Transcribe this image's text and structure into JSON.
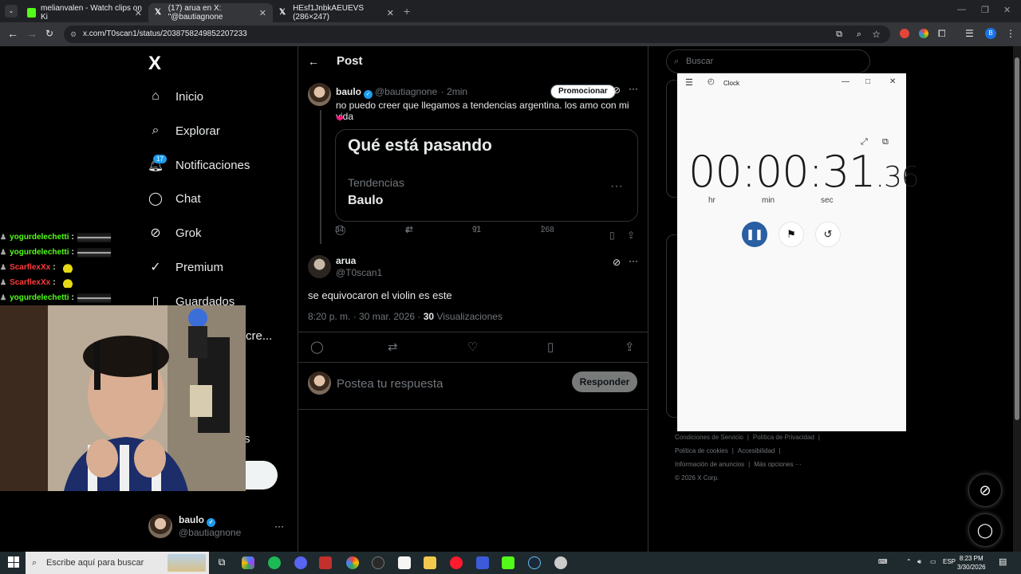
{
  "browser": {
    "tabs": [
      {
        "label": "melianvalen - Watch clips on Ki",
        "active": false,
        "icon_color": "#53fc18"
      },
      {
        "label": "(17) arua en X: \"@bautiagnone",
        "active": true,
        "icon_color": "#ffffff"
      },
      {
        "label": "HEsf1JnbkAEUEVS (286×247)",
        "active": false,
        "icon_color": "#ffffff"
      }
    ],
    "new_tab": "+",
    "url": "x.com/T0scan1/status/2038758249852207233"
  },
  "sidebar": {
    "logo": "X",
    "items": [
      {
        "label": "Inicio",
        "icon": "home-icon"
      },
      {
        "label": "Explorar",
        "icon": "search-icon"
      },
      {
        "label": "Notificaciones",
        "icon": "bell-icon"
      },
      {
        "label": "Chat",
        "icon": "chat-icon"
      },
      {
        "label": "Grok",
        "icon": "grok-icon"
      },
      {
        "label": "Premium",
        "icon": "premium-icon"
      },
      {
        "label": "Guardados",
        "icon": "bookmark-icon"
      }
    ],
    "notif_badge": "17",
    "partial_text_1": "cre...",
    "partial_text_2": "s",
    "account": {
      "name": "baulo",
      "handle": "@bautiagnone",
      "more": "···"
    }
  },
  "chat_overlay": [
    {
      "user": "yogurdelechetti",
      "color": "#53fc18",
      "sep": ":"
    },
    {
      "user": "yogurdelechetti",
      "color": "#53fc18",
      "sep": ":"
    },
    {
      "user": "ScarflexXx",
      "color": "#ff3b3b",
      "sep": ":"
    },
    {
      "user": "ScarflexXx",
      "color": "#ff3b3b",
      "sep": ":"
    },
    {
      "user": "yogurdelechetti",
      "color": "#53fc18",
      "sep": ":"
    }
  ],
  "post": {
    "header": "Post",
    "quoted": {
      "name": "baulo",
      "handle": "@bautiagnone",
      "time": "· 2min",
      "promote": "Promocionar",
      "text": "no puedo creer que llegamos a tendencias argentina. los amo con mi vida",
      "heart": "❤",
      "card": {
        "title": "Qué está pasando",
        "subtitle": "Tendencias",
        "trend": "Baulo",
        "dots": "···"
      },
      "stats": {
        "replies": "34",
        "reposts": "4",
        "likes": "91",
        "views": "268"
      }
    },
    "reply": {
      "name": "arua",
      "handle": "@T0scan1",
      "text": "se equivocaron el violin es este",
      "time": "8:20 p. m. · 30 mar. 2026 · ",
      "views_count": "30",
      "views_label": " Visualizaciones"
    },
    "compose": {
      "placeholder": "Postea tu respuesta",
      "button": "Responder"
    }
  },
  "right": {
    "search_placeholder": "Buscar",
    "footer": [
      "Condiciones de Servicio",
      "Política de Privacidad",
      "Política de cookies",
      "Accesibilidad",
      "Información de anuncios",
      "Más opciones ···",
      "© 2026 X Corp."
    ]
  },
  "clock_app": {
    "title": "Clock",
    "time_main": "00:00:31",
    "time_ms": ".36",
    "units": [
      "hr",
      "min",
      "sec"
    ]
  },
  "taskbar": {
    "search_placeholder": "Escribe aquí para buscar",
    "lang": "ESP",
    "time": "8:23 PM",
    "date": "3/30/2026"
  }
}
